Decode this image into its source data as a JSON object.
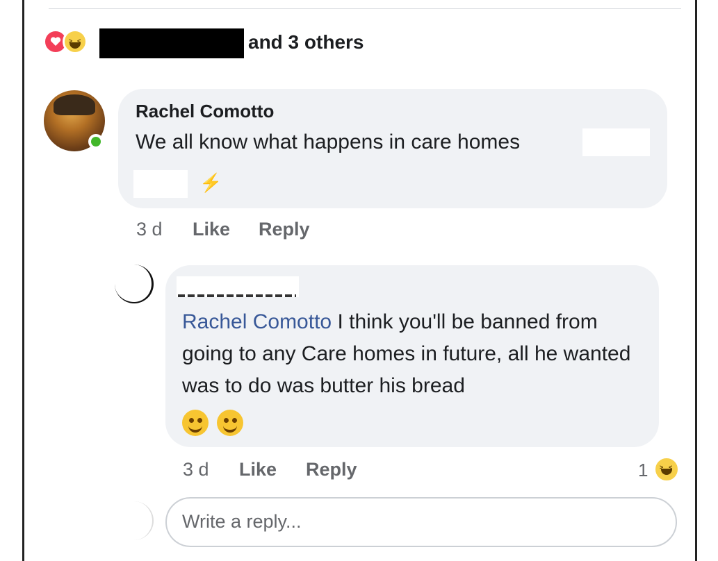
{
  "reactions": {
    "others_text": "and 3 others",
    "types": [
      "love-icon",
      "haha-icon"
    ]
  },
  "comment": {
    "author": "Rachel Comotto",
    "text": "We all know what happens in care homes",
    "time": "3 d",
    "like_label": "Like",
    "reply_label": "Reply"
  },
  "reply": {
    "mention": "Rachel Comotto",
    "text": " I think you'll be banned from going to any Care homes in future, all he wanted was to do was butter his bread",
    "time": "3 d",
    "like_label": "Like",
    "reply_label": "Reply",
    "reaction_count": "1",
    "reaction_type": "haha-icon"
  },
  "composer": {
    "placeholder": "Write a reply..."
  },
  "colors": {
    "bubble": "#f0f2f5",
    "mention": "#385898",
    "online": "#42b72a",
    "love": "#f33e58",
    "haha": "#f7d04a"
  }
}
